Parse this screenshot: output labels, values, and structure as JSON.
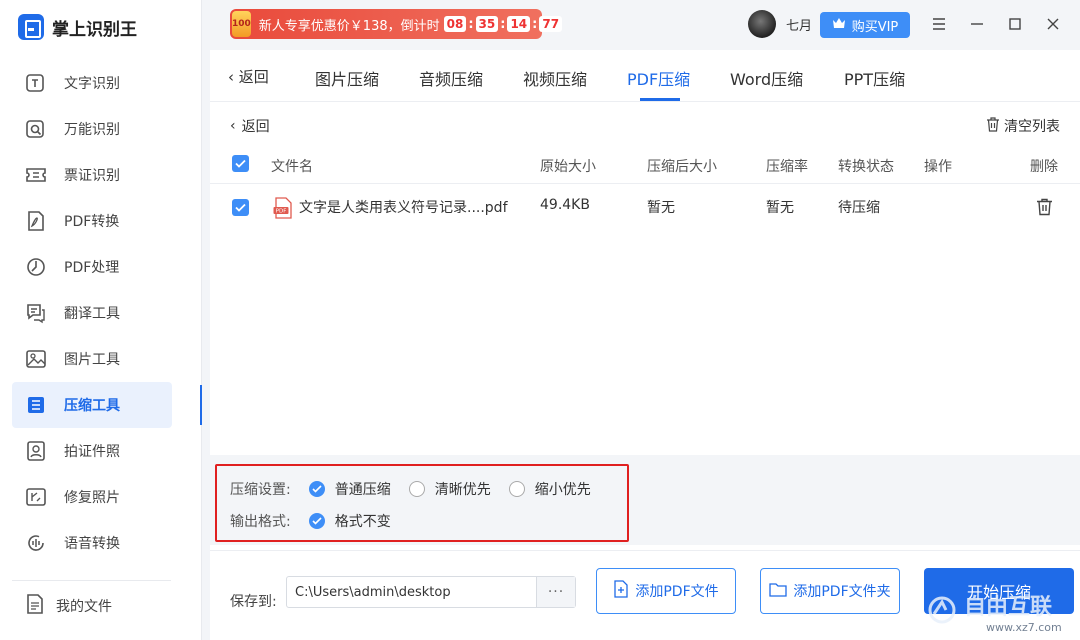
{
  "app": {
    "name": "掌上识别王"
  },
  "sidebar": {
    "items": [
      {
        "label": "文字识别",
        "icon": "text-recognition-icon"
      },
      {
        "label": "万能识别",
        "icon": "universal-recognition-icon"
      },
      {
        "label": "票证识别",
        "icon": "ticket-recognition-icon"
      },
      {
        "label": "PDF转换",
        "icon": "pdf-convert-icon"
      },
      {
        "label": "PDF处理",
        "icon": "pdf-process-icon"
      },
      {
        "label": "翻译工具",
        "icon": "translate-icon"
      },
      {
        "label": "图片工具",
        "icon": "image-tools-icon"
      },
      {
        "label": "压缩工具",
        "icon": "compress-icon",
        "active": true
      },
      {
        "label": "拍证件照",
        "icon": "id-photo-icon"
      },
      {
        "label": "修复照片",
        "icon": "repair-photo-icon"
      },
      {
        "label": "语音转换",
        "icon": "voice-convert-icon"
      }
    ],
    "my_files": "我的文件"
  },
  "topbar": {
    "promo_badge": "100",
    "promo_text": "新人专享优惠价￥138，倒计时",
    "timer": [
      "08",
      "35",
      "14",
      "77"
    ],
    "timer_sep": ":",
    "username": "七月",
    "vip_label": "购买VIP"
  },
  "tabs": {
    "back": "返回",
    "items": [
      "图片压缩",
      "音频压缩",
      "视频压缩",
      "PDF压缩",
      "Word压缩",
      "PPT压缩"
    ],
    "active": "PDF压缩"
  },
  "list": {
    "back": "返回",
    "clear": "清空列表",
    "columns": [
      "文件名",
      "原始大小",
      "压缩后大小",
      "压缩率",
      "转换状态",
      "操作",
      "删除"
    ],
    "rows": [
      {
        "filename": "文字是人类用表义符号记录....pdf",
        "file_icon": "PDF",
        "original_size": "49.4KB",
        "compressed_size": "暂无",
        "ratio": "暂无",
        "status": "待压缩"
      }
    ]
  },
  "settings": {
    "compress_label": "压缩设置:",
    "compress_options": [
      {
        "label": "普通压缩",
        "selected": true
      },
      {
        "label": "清晰优先",
        "selected": false
      },
      {
        "label": "缩小优先",
        "selected": false
      }
    ],
    "output_label": "输出格式:",
    "output_option": {
      "label": "格式不变",
      "selected": true
    }
  },
  "footer": {
    "save_to": "保存到:",
    "path": "C:\\Users\\admin\\desktop",
    "more": "···",
    "add_file": "添加PDF文件",
    "add_folder": "添加PDF文件夹",
    "start": "开始压缩"
  },
  "watermark": {
    "text": "自由互联",
    "url": "www.xz7.com"
  },
  "colors": {
    "accent": "#1f6be8",
    "checkbox": "#3e8ef7",
    "promo": "#e94a3b",
    "highlight_box": "#e02020"
  }
}
